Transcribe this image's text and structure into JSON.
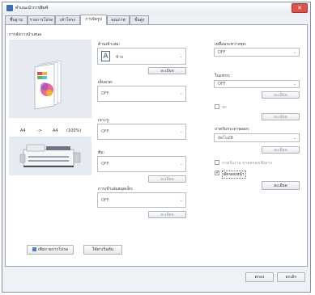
{
  "window": {
    "title": "คำแนะนำการพิมพ์"
  },
  "tabs": [
    "พื้นฐาน",
    "รายการโปรด",
    "เค้าโครง",
    "การจัดรูป",
    "คุณภาพ",
    "ขั้นสูง"
  ],
  "preview": {
    "label": "การจัดวางนำเสนอ",
    "size_from": "A4",
    "arrow": "->",
    "size_to": "A4",
    "zoom": "(100%)"
  },
  "middle": {
    "binding": {
      "label": "ด้านเข้าเล่ม:",
      "value": "ซ้าย",
      "details": "ละเอียด"
    },
    "staple": {
      "label": "เย็บลวด:",
      "value": "OFF"
    },
    "punch": {
      "label": "เจาะรู:",
      "value": "OFF"
    },
    "fold": {
      "label": "พับ:",
      "value": "OFF",
      "details": "ละเอียด"
    },
    "booklet": {
      "label": "การเข้าเล่มสมุดเล็ก:",
      "value": "OFF",
      "details": "ละเอียด"
    }
  },
  "right": {
    "offset": {
      "label": "เหลื่อมระหว่างชุด:",
      "value": "OFF"
    },
    "insert": {
      "label": "ใบแทรก:",
      "value": "OFF",
      "details": "ละเอียด"
    },
    "cover": {
      "label": "ปก",
      "details": "ละเอียด"
    },
    "output": {
      "label": "ถาดรับกระดาษออก:",
      "value": "อัตโนมัติ",
      "details": "ละเอียด"
    },
    "facedown": {
      "label": "ถาดรับงาน ขาออกลงเชิงล่าง"
    },
    "trim": {
      "label": "ตัดขอบหน้า",
      "details": "ละเอียด"
    }
  },
  "bottom": {
    "add_favorite": "เพิ่มรายการโปรด",
    "restore": "ใช้ค่าเริ่มต้น",
    "ok": "ตกลง",
    "cancel": "ยกเลิก"
  }
}
